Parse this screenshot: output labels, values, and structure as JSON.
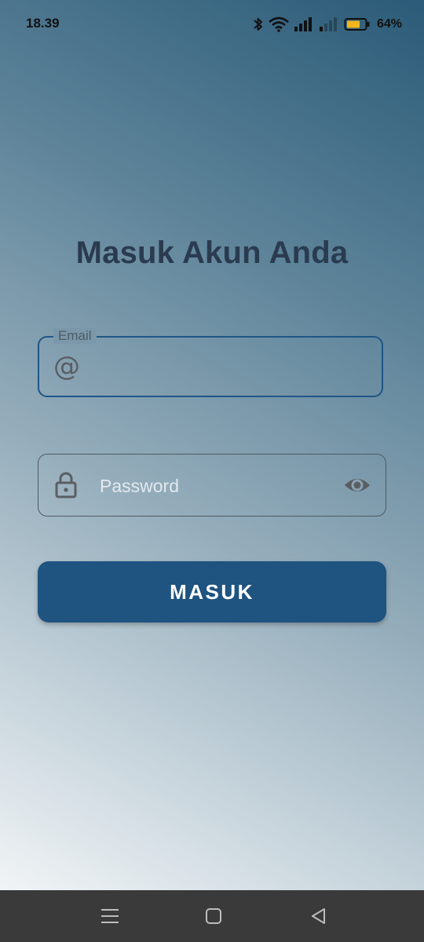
{
  "status_bar": {
    "time": "18.39",
    "battery_percent": "64%",
    "icons": [
      "bluetooth-icon",
      "wifi-icon",
      "signal-icon",
      "signal-weak-icon",
      "battery-icon"
    ]
  },
  "login": {
    "title": "Masuk Akun Anda",
    "email_label": "Email",
    "email_value": "",
    "email_icon": "at-icon",
    "password_placeholder": "Password",
    "password_icon": "lock-icon",
    "password_toggle_icon": "eye-icon",
    "submit_label": "MASUK"
  },
  "navigation": {
    "buttons": [
      "menu-icon",
      "home-icon",
      "back-icon"
    ]
  },
  "colors": {
    "primary": "#1f5380",
    "focus_border": "#1f5687",
    "title": "#2a3b50",
    "gradient_top": "#2b5b78",
    "gradient_bottom": "#f1f4f6"
  }
}
